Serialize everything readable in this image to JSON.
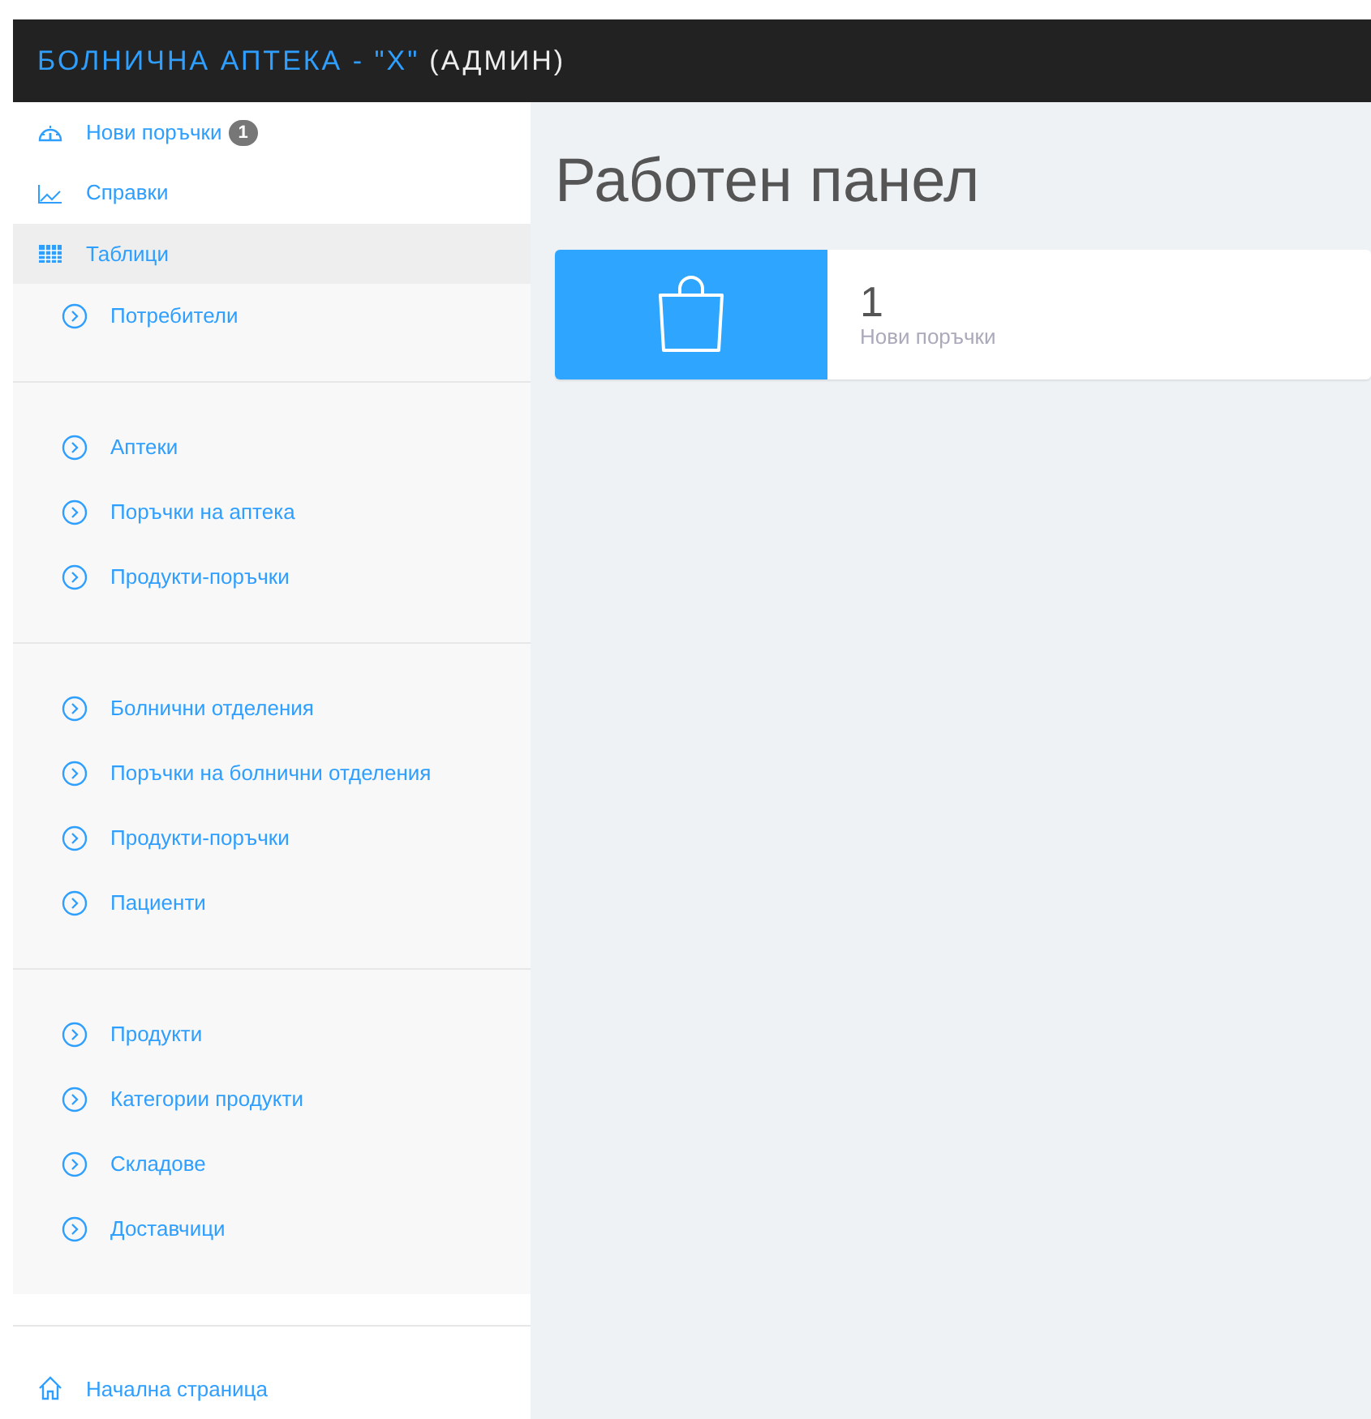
{
  "header": {
    "title": "БОЛНИЧНА АПТЕКА - \"X\"",
    "role": "(АДМИН)"
  },
  "sidebar": {
    "items": [
      {
        "kind": "dashboard",
        "label": "Нови поръчки",
        "badge": "1",
        "selected": false
      },
      {
        "kind": "chart",
        "label": "Справки",
        "selected": false
      },
      {
        "kind": "table",
        "label": "Таблици",
        "selected": true
      }
    ],
    "groups": [
      [
        "Потребители"
      ],
      [
        "Аптеки",
        "Поръчки на аптека",
        "Продукти-поръчки"
      ],
      [
        "Болнични отделения",
        "Поръчки на болнични отделения",
        "Продукти-поръчки",
        "Пациенти"
      ],
      [
        "Продукти",
        "Категории продукти",
        "Складове",
        "Доставчици"
      ]
    ],
    "home": {
      "label": "Начална страница"
    }
  },
  "main": {
    "title": "Работен панел",
    "cards": [
      {
        "value": "1",
        "label": "Нови поръчки"
      }
    ]
  }
}
